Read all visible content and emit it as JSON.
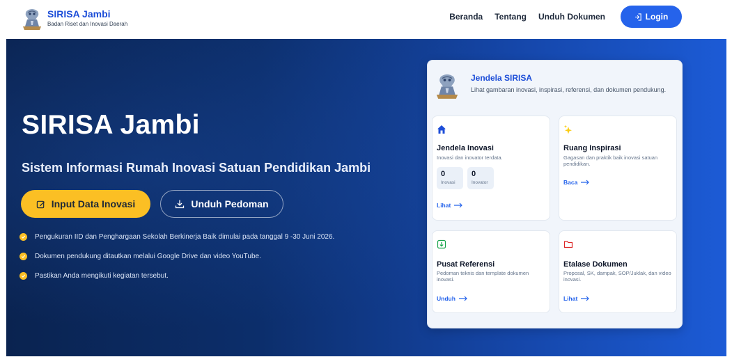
{
  "brand": {
    "title": "SIRISA Jambi",
    "subtitle": "Badan Riset dan Inovasi Daerah"
  },
  "nav": {
    "links": [
      "Beranda",
      "Tentang",
      "Unduh Dokumen"
    ],
    "login_label": "Login"
  },
  "hero": {
    "title": "SIRISA Jambi",
    "subtitle": "Sistem Informasi Rumah Inovasi Satuan Pendidikan Jambi",
    "primary_button": "Input Data Inovasi",
    "secondary_button": "Unduh Pedoman",
    "bullets": [
      "Pengukuran IID dan Penghargaan Sekolah Berkinerja Baik dimulai pada tanggal 9 -30 Juni 2026.",
      "Dokumen pendukung ditautkan melalui Google Drive dan video YouTube.",
      "Pastikan Anda mengikuti kegiatan tersebut."
    ]
  },
  "panel": {
    "title": "Jendela SIRISA",
    "description": "Lihat gambaran inovasi, inspirasi, referensi, dan dokumen pendukung.",
    "cards": [
      {
        "icon": "home-icon",
        "title": "Jendela Inovasi",
        "description": "Inovasi dan inovator terdata.",
        "stats": [
          {
            "value": "0",
            "label": "Inovasi"
          },
          {
            "value": "0",
            "label": "Inovator"
          }
        ],
        "link": "Lihat"
      },
      {
        "icon": "sparkles-icon",
        "title": "Ruang Inspirasi",
        "description": "Gagasan dan praktik baik inovasi satuan pendidikan.",
        "link": "Baca"
      },
      {
        "icon": "download-document-icon",
        "title": "Pusat Referensi",
        "description": "Pedoman teknis dan template dokumen inovasi.",
        "link": "Unduh"
      },
      {
        "icon": "folder-icon",
        "title": "Etalase Dokumen",
        "description": "Proposal, SK, dampak, SOP/Juklak, dan video inovasi.",
        "link": "Lihat"
      }
    ]
  },
  "colors": {
    "brand_blue": "#1d4ed8",
    "accent_yellow": "#fbbf24",
    "hero_dark": "#0a2350",
    "hero_light": "#1c5bd6"
  }
}
